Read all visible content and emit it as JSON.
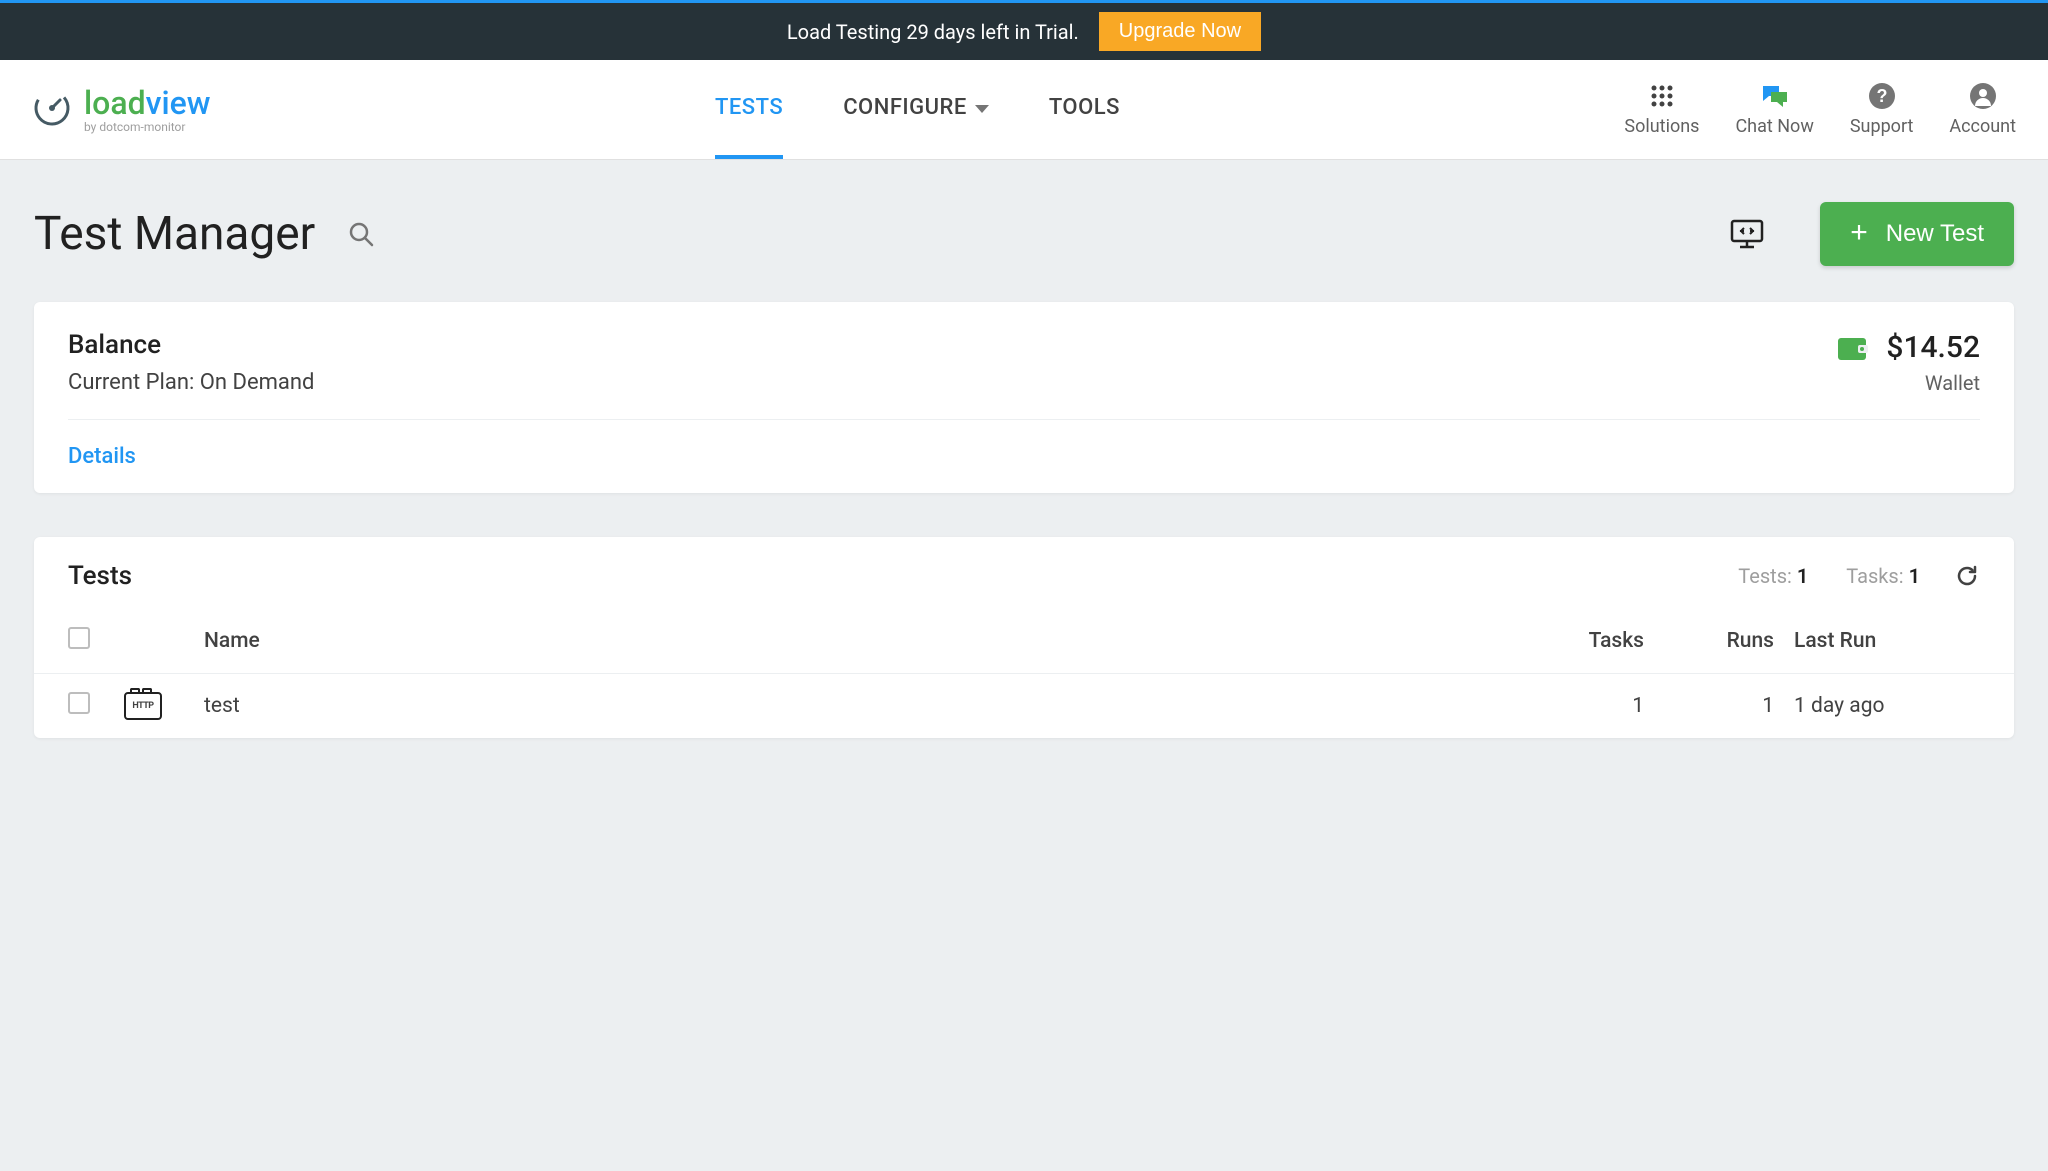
{
  "banner": {
    "trial_text": "Load Testing 29 days left in Trial.",
    "upgrade_label": "Upgrade Now"
  },
  "logo": {
    "part1": "load",
    "part2": "view",
    "subtitle": "by dotcom-monitor"
  },
  "nav": {
    "tests": "TESTS",
    "configure": "CONFIGURE",
    "tools": "TOOLS"
  },
  "header_actions": {
    "solutions": "Solutions",
    "chat": "Chat Now",
    "support": "Support",
    "account": "Account"
  },
  "page": {
    "title": "Test Manager",
    "new_test_label": "New Test"
  },
  "balance": {
    "title": "Balance",
    "plan_prefix": "Current Plan: ",
    "plan_name": "On Demand",
    "amount": "$14.52",
    "wallet_label": "Wallet",
    "details_label": "Details"
  },
  "tests": {
    "title": "Tests",
    "counts": {
      "tests_label": "Tests: ",
      "tests_value": "1",
      "tasks_label": "Tasks: ",
      "tasks_value": "1"
    },
    "columns": {
      "name": "Name",
      "tasks": "Tasks",
      "runs": "Runs",
      "last_run": "Last Run"
    },
    "rows": [
      {
        "name": "test",
        "tasks": "1",
        "runs": "1",
        "last_run": "1 day ago"
      }
    ]
  }
}
